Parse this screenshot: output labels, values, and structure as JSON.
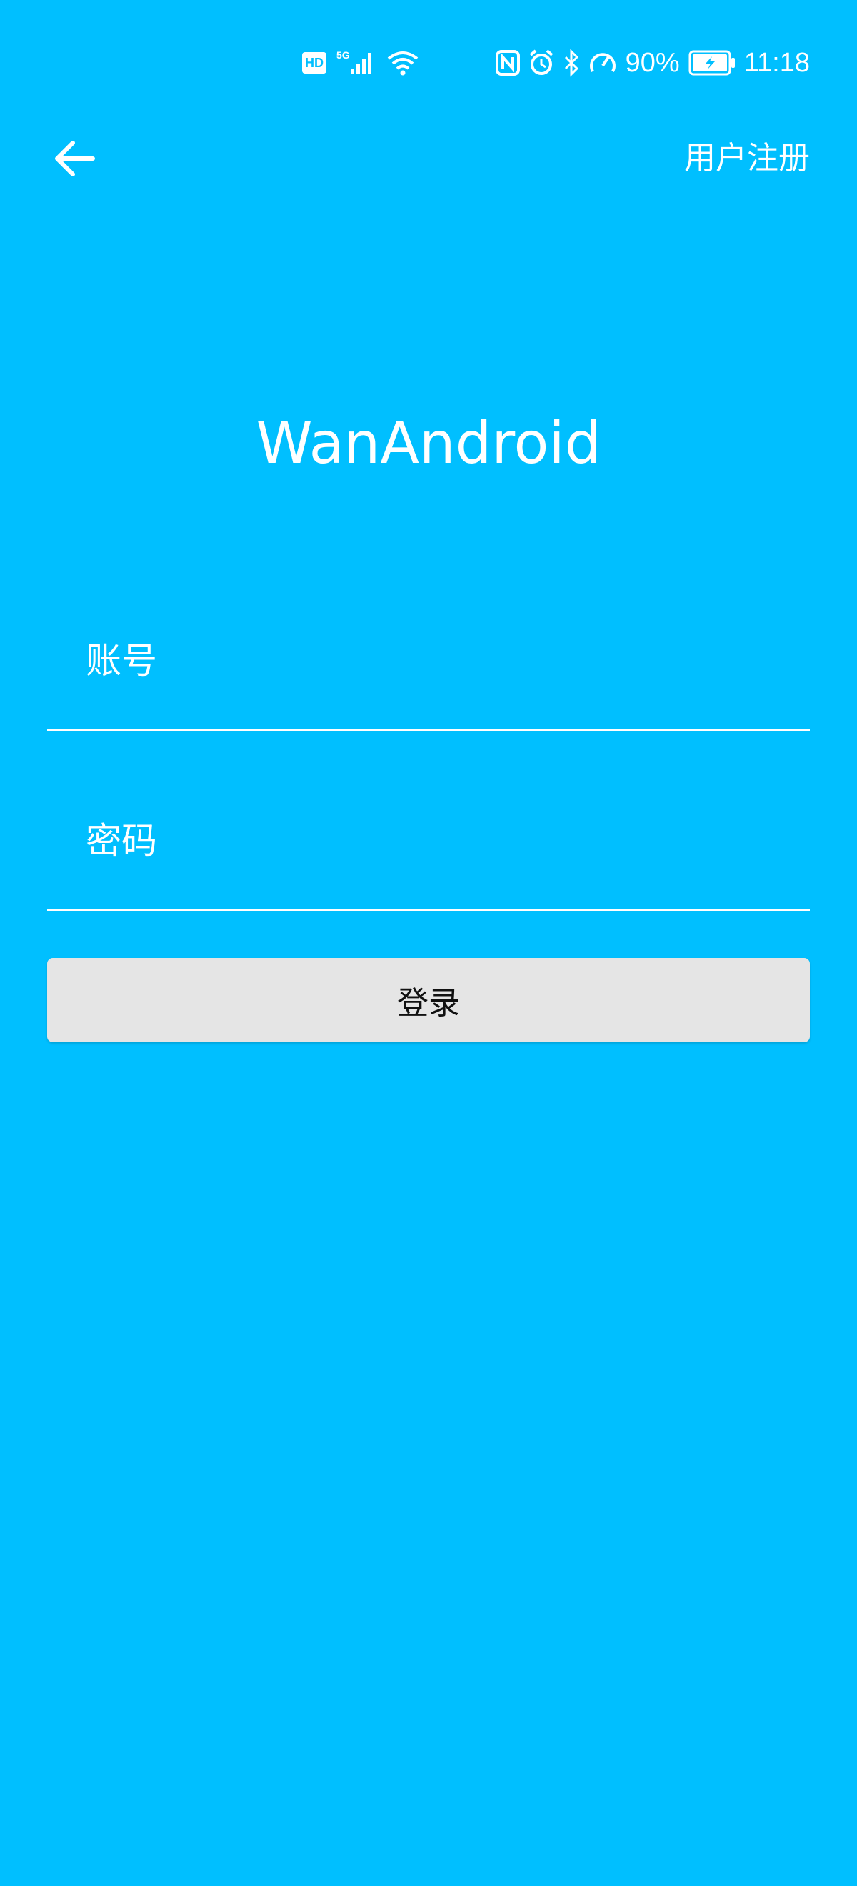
{
  "status_bar": {
    "hd_label": "HD",
    "network_label": "5G",
    "battery_percent": "90%",
    "time": "11:18",
    "icons": [
      "hd-icon",
      "signal-icon",
      "wifi-icon",
      "nfc-icon",
      "alarm-icon",
      "bluetooth-icon",
      "speed-icon",
      "battery-charging-icon"
    ]
  },
  "toolbar": {
    "back_icon": "arrow-left-icon",
    "register_label": "用户注册"
  },
  "app_title": "WanAndroid",
  "form": {
    "account_placeholder": "账号",
    "account_value": "",
    "password_placeholder": "密码",
    "password_value": "",
    "login_label": "登录"
  },
  "colors": {
    "background": "#00BFFF",
    "button_bg": "#E5E5E5",
    "text": "#FFFFFF"
  }
}
